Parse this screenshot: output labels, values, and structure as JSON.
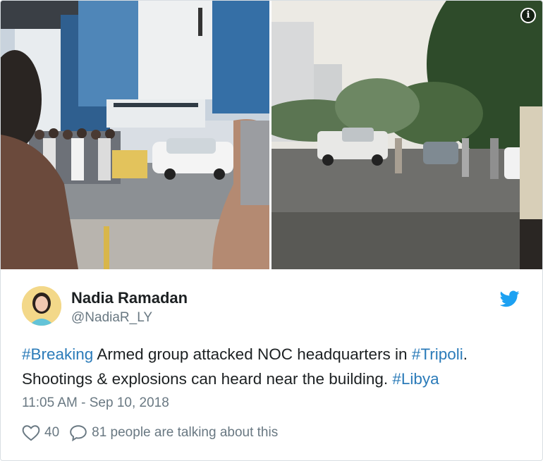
{
  "tweet": {
    "display_name": "Nadia Ramadan",
    "handle": "@NadiaR_LY",
    "text_parts": {
      "tag1": "#Breaking",
      "text1": " Armed group attacked NOC headquarters in ",
      "tag2": "#Tripoli",
      "text2": ". Shootings & explosions can heard near the building. ",
      "tag3": "#Libya"
    },
    "timestamp": "11:05 AM - Sep 10, 2018",
    "like_count": "40",
    "conversation_text": "81 people are talking about this"
  },
  "media": {
    "left_alt_icon": "photo-left",
    "right_alt_icon": "photo-right",
    "info_glyph": "i"
  },
  "icons": {
    "brand": "twitter-bird-icon",
    "like": "heart-icon",
    "reply": "speech-bubble-icon",
    "info": "info-icon"
  },
  "colors": {
    "link": "#2b7bb9",
    "brand": "#1da1f2",
    "text": "#1c2022",
    "muted": "#697882"
  }
}
